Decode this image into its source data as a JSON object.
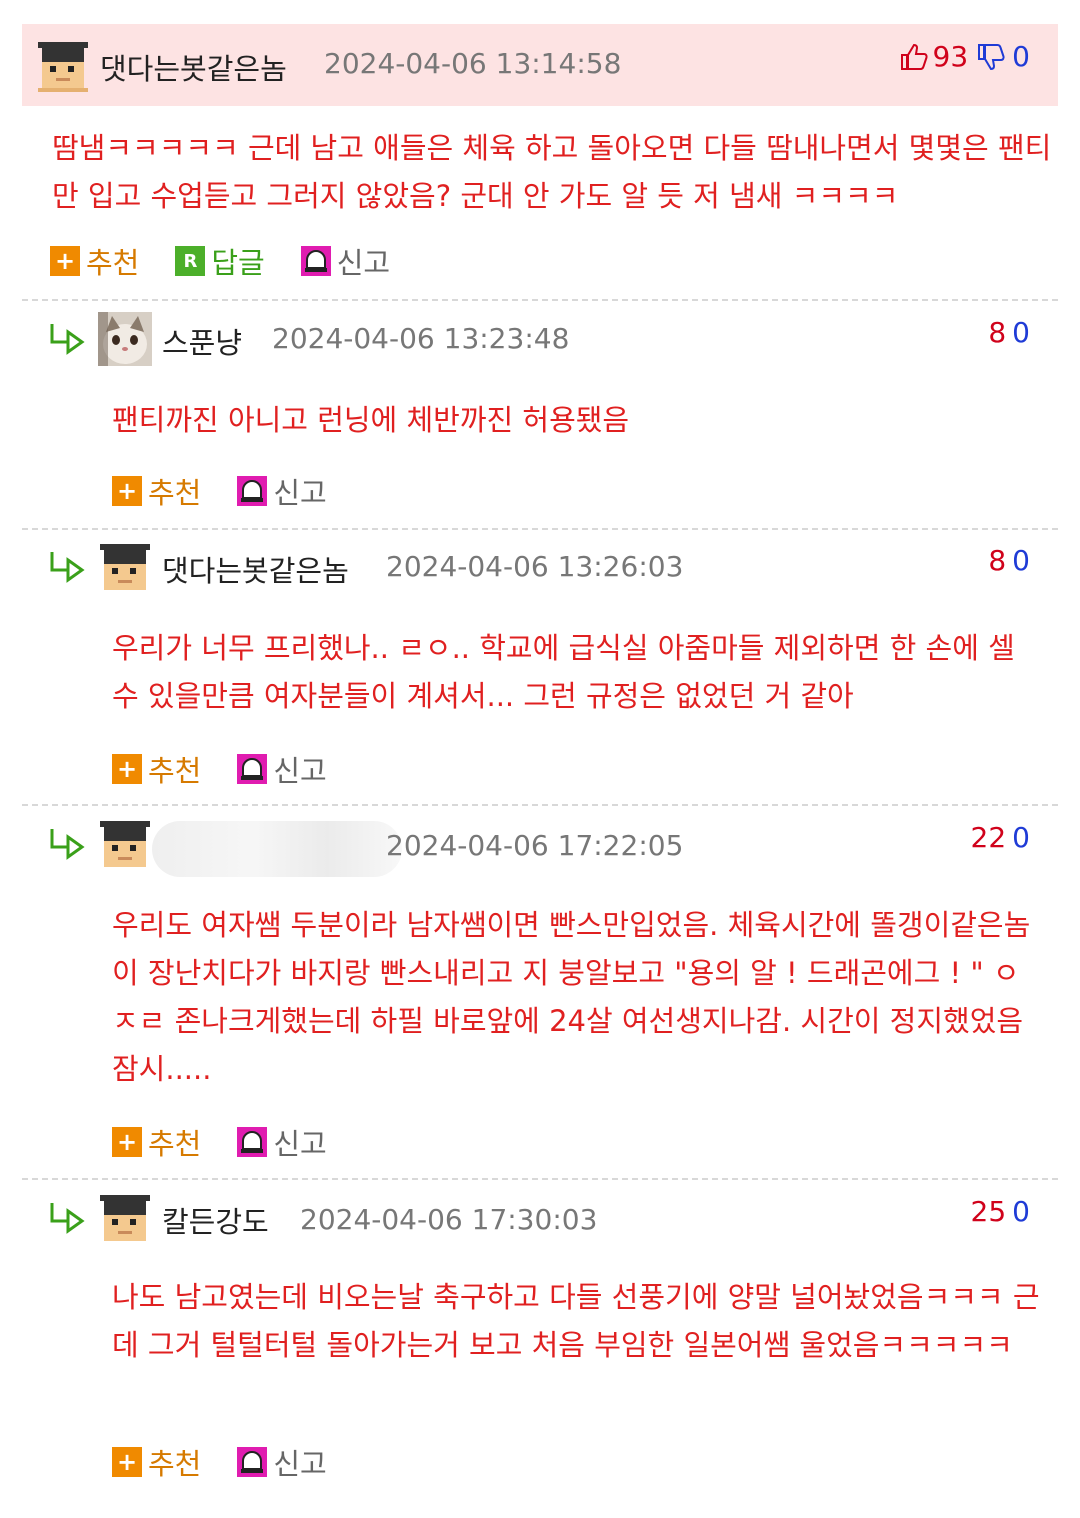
{
  "main": {
    "nickname": "댓다는봇같은놈",
    "date": "2024-04-06 13:14:58",
    "up_votes": "93",
    "down_votes": "0",
    "body": "땀냄ㅋㅋㅋㅋㅋ 근데 남고 애들은 체육 하고 돌아오면 다들 땀내나면서 몇몇은 팬티만 입고 수업듣고 그러지 않았음? 군대 안 가도 알 듯 저 냄새 ㅋㅋㅋㅋ",
    "actions": {
      "recommend": "추천",
      "reply": "답글",
      "report": "신고"
    }
  },
  "replies": [
    {
      "nickname": "스푼냥",
      "date": "2024-04-06 13:23:48",
      "up": "8",
      "down": "0",
      "body": "팬티까진 아니고 런닝에 체반까진 허용됐음",
      "recommend": "추천",
      "report": "신고",
      "avatar": "cat-photo"
    },
    {
      "nickname": "댓다는봇같은놈",
      "date": "2024-04-06 13:26:03",
      "up": "8",
      "down": "0",
      "body": "우리가 너무 프리했나.. ㄹㅇ.. 학교에 급식실 아줌마들 제외하면 한 손에 셀 수 있을만큼 여자분들이 계셔서... 그런 규정은 없었던 거 같아",
      "recommend": "추천",
      "report": "신고",
      "avatar": "pixel-face"
    },
    {
      "nickname": "",
      "date": "2024-04-06 17:22:05",
      "up": "22",
      "down": "0",
      "body": "우리도 여자쌤 두분이라 남자쌤이면 빤스만입었음. 체육시간에 똘갱이같은놈이 장난치다가 바지랑 빤스내리고 지 붕알보고 \"용의 알 ! 드래곤에그 ! \" ㅇㅈㄹ 존나크게했는데 하필 바로앞에 24살 여선생지나감. 시간이 정지했었음 잠시.....",
      "recommend": "추천",
      "report": "신고",
      "avatar": "pixel-face"
    },
    {
      "nickname": "칼든강도",
      "date": "2024-04-06 17:30:03",
      "up": "25",
      "down": "0",
      "body": "나도 남고였는데 비오는날 축구하고 다들 선풍기에 양말 널어놨었음ㅋㅋㅋ 근데 그거 털털터털 돌아가는거 보고 처음 부임한 일본어쌤 울었음ㅋㅋㅋㅋㅋ",
      "recommend": "추천",
      "report": "신고",
      "avatar": "pixel-face"
    }
  ],
  "colors": {
    "comment_text": "#e02020",
    "header_bg": "#fde3e3",
    "up_vote": "#d0021b",
    "down_vote": "#1f3bd6"
  }
}
